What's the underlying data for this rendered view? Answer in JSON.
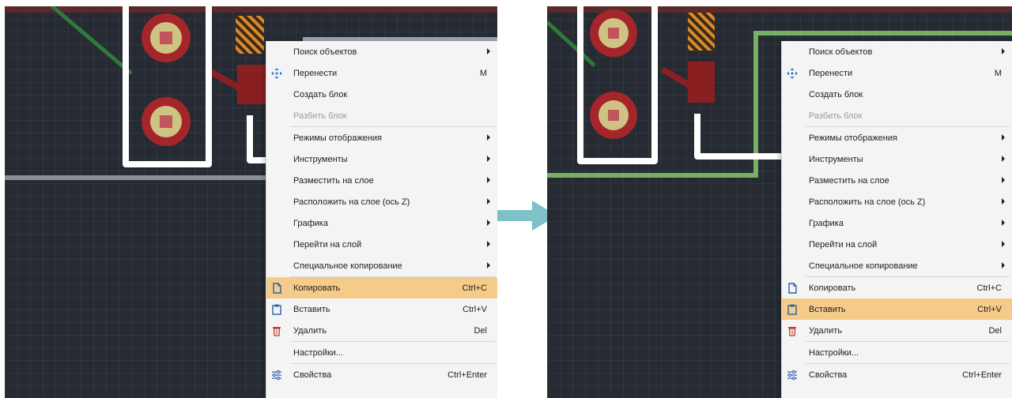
{
  "colors": {
    "board_bg": "#252a33",
    "menu_bg": "#f4f4f4",
    "highlight": "#f5cb8a",
    "arrow": "#7ec2c9",
    "trace_white": "#ffffff",
    "trace_green": "#7fbf6a",
    "pad_red": "#b0272c",
    "pad_cream": "#d6c98a"
  },
  "steps": [
    {
      "highlighted_item": "Копировать",
      "menu": {
        "items": [
          {
            "label": "Поиск объектов",
            "submenu": true,
            "icon": ""
          },
          {
            "label": "Перенести",
            "shortcut": "M",
            "icon": "move-icon"
          },
          {
            "label": "Создать блок",
            "icon": ""
          },
          {
            "label": "Разбить блок",
            "disabled": true,
            "icon": ""
          },
          {
            "label": "Режимы отображения",
            "submenu": true,
            "icon": ""
          },
          {
            "label": "Инструменты",
            "submenu": true,
            "icon": ""
          },
          {
            "label": "Разместить на слое",
            "submenu": true,
            "icon": ""
          },
          {
            "label": "Расположить на слое (ось Z)",
            "submenu": true,
            "icon": ""
          },
          {
            "label": "Графика",
            "submenu": true,
            "icon": ""
          },
          {
            "label": "Перейти на слой",
            "submenu": true,
            "icon": ""
          },
          {
            "label": "Специальное копирование",
            "submenu": true,
            "icon": ""
          },
          {
            "label": "Копировать",
            "shortcut": "Ctrl+C",
            "icon": "copy-icon",
            "highlighted": true
          },
          {
            "label": "Вставить",
            "shortcut": "Ctrl+V",
            "icon": "paste-icon"
          },
          {
            "label": "Удалить",
            "shortcut": "Del",
            "icon": "trash-icon"
          },
          {
            "label": "Настройки...",
            "icon": ""
          },
          {
            "label": "Свойства",
            "shortcut": "Ctrl+Enter",
            "icon": "properties-icon"
          }
        ]
      }
    },
    {
      "highlighted_item": "Вставить",
      "menu": {
        "items": [
          {
            "label": "Поиск объектов",
            "submenu": true,
            "icon": ""
          },
          {
            "label": "Перенести",
            "shortcut": "M",
            "icon": "move-icon"
          },
          {
            "label": "Создать блок",
            "icon": ""
          },
          {
            "label": "Разбить блок",
            "disabled": true,
            "icon": ""
          },
          {
            "label": "Режимы отображения",
            "submenu": true,
            "icon": ""
          },
          {
            "label": "Инструменты",
            "submenu": true,
            "icon": ""
          },
          {
            "label": "Разместить на слое",
            "submenu": true,
            "icon": ""
          },
          {
            "label": "Расположить на слое (ось Z)",
            "submenu": true,
            "icon": ""
          },
          {
            "label": "Графика",
            "submenu": true,
            "icon": ""
          },
          {
            "label": "Перейти на слой",
            "submenu": true,
            "icon": ""
          },
          {
            "label": "Специальное копирование",
            "submenu": true,
            "icon": ""
          },
          {
            "label": "Копировать",
            "shortcut": "Ctrl+C",
            "icon": "copy-icon"
          },
          {
            "label": "Вставить",
            "shortcut": "Ctrl+V",
            "icon": "paste-icon",
            "highlighted": true
          },
          {
            "label": "Удалить",
            "shortcut": "Del",
            "icon": "trash-icon"
          },
          {
            "label": "Настройки...",
            "icon": ""
          },
          {
            "label": "Свойства",
            "shortcut": "Ctrl+Enter",
            "icon": "properties-icon"
          }
        ]
      }
    }
  ]
}
